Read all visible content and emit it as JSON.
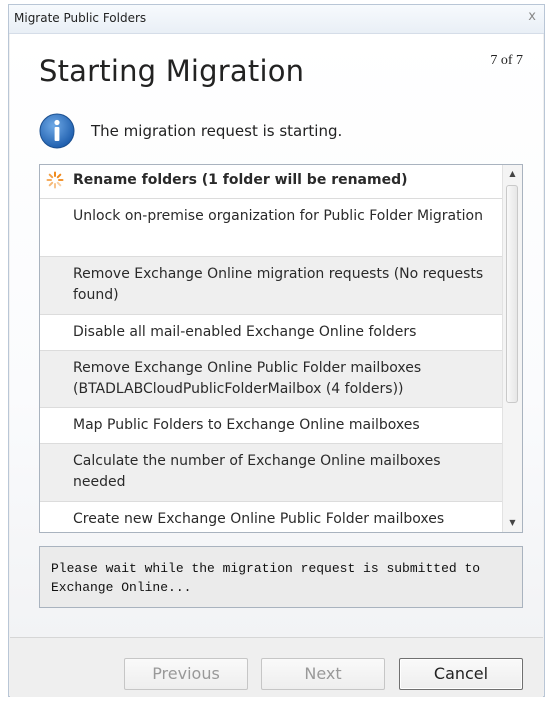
{
  "window": {
    "title": "Migrate Public Folders",
    "close_glyph": "x"
  },
  "header": {
    "title": "Starting Migration",
    "step": "7 of 7"
  },
  "info": {
    "icon": "info-icon",
    "message": "The migration request is starting."
  },
  "tasks": [
    {
      "label": "Rename folders (1 folder will be renamed)",
      "state": "in-progress",
      "icon": "spinner-icon"
    },
    {
      "label": "Unlock on-premise organization for Public Folder Migration"
    },
    {
      "label": "Remove Exchange Online migration requests (No requests found)"
    },
    {
      "label": "Disable all mail-enabled Exchange Online folders"
    },
    {
      "label": "Remove Exchange Online Public Folder mailboxes (BTADLABCloudPublicFolderMailbox (4 folders))"
    },
    {
      "label": "Map Public Folders to Exchange Online mailboxes"
    },
    {
      "label": "Calculate the number of Exchange Online mailboxes needed"
    },
    {
      "label": "Create new Exchange Online Public Folder mailboxes"
    }
  ],
  "status_text": "Please wait while the migration request is submitted to Exchange Online...",
  "buttons": {
    "previous": "Previous",
    "next": "Next",
    "cancel": "Cancel"
  },
  "colors": {
    "info_icon": "#2a6ebd",
    "spinner": "#f08a1c"
  }
}
